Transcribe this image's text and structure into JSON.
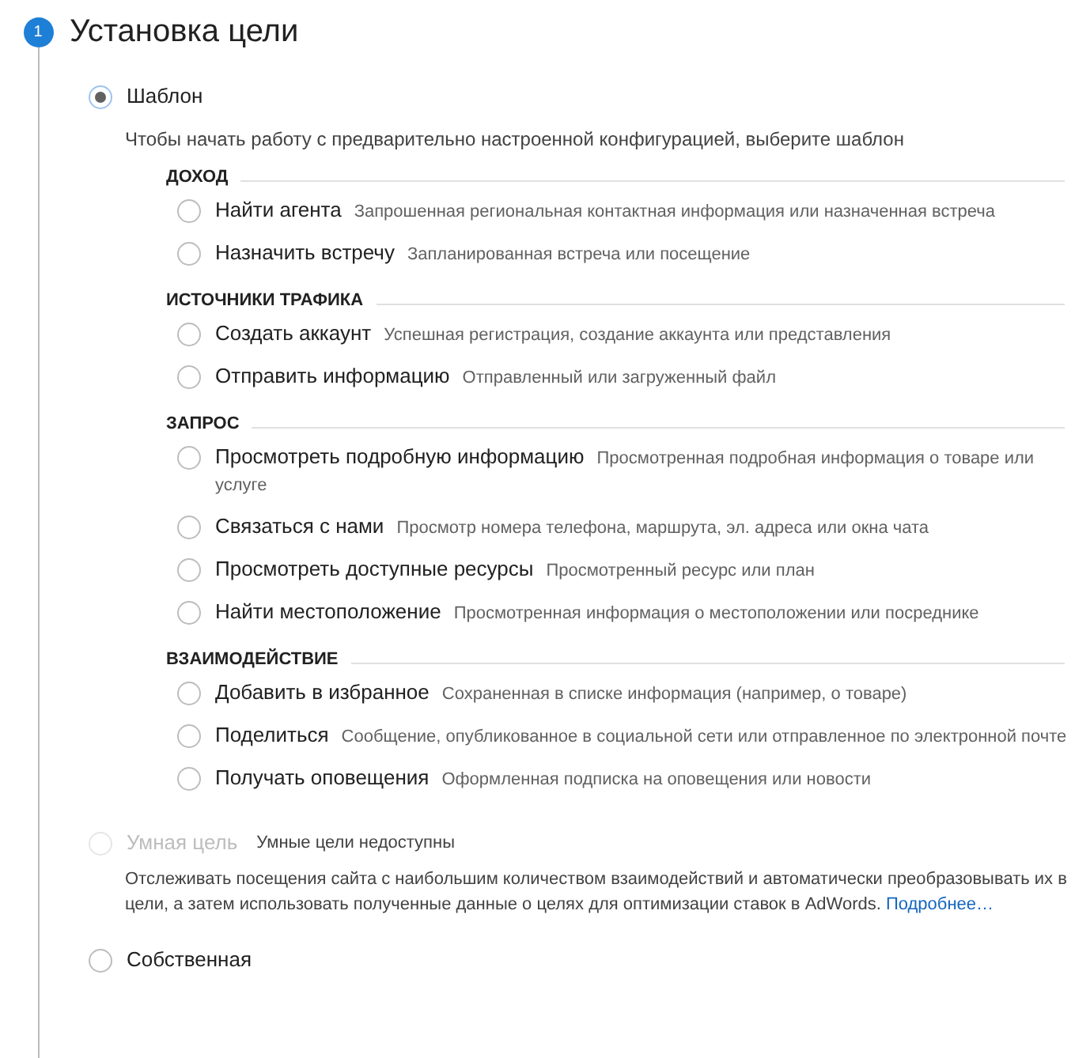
{
  "step": {
    "number": "1",
    "title": "Установка цели"
  },
  "options": [
    {
      "label": "Шаблон",
      "selected": true,
      "disabled": false,
      "description": "Чтобы начать работу с предварительно настроенной конфигурацией, выберите шаблон",
      "groups": [
        {
          "heading": "ДОХОД",
          "items": [
            {
              "label": "Найти агента",
              "description": "Запрошенная региональная контактная информация или назначенная встреча",
              "selected": false
            },
            {
              "label": "Назначить встречу",
              "description": "Запланированная встреча или посещение",
              "selected": false
            }
          ]
        },
        {
          "heading": "ИСТОЧНИКИ ТРАФИКА",
          "items": [
            {
              "label": "Создать аккаунт",
              "description": "Успешная регистрация, создание аккаунта или представления",
              "selected": false
            },
            {
              "label": "Отправить информацию",
              "description": "Отправленный или загруженный файл",
              "selected": false
            }
          ]
        },
        {
          "heading": "ЗАПРОС",
          "items": [
            {
              "label": "Просмотреть подробную информацию",
              "description": "Просмотренная подробная информация о товаре или услуге",
              "selected": false
            },
            {
              "label": "Связаться с нами",
              "description": "Просмотр номера телефона, маршрута, эл. адреса или окна чата",
              "selected": false
            },
            {
              "label": "Просмотреть доступные ресурсы",
              "description": "Просмотренный ресурс или план",
              "selected": false
            },
            {
              "label": "Найти местоположение",
              "description": "Просмотренная информация о местоположении или посреднике",
              "selected": false
            }
          ]
        },
        {
          "heading": "ВЗАИМОДЕЙСТВИЕ",
          "items": [
            {
              "label": "Добавить в избранное",
              "description": "Сохраненная в списке информация (например, о товаре)",
              "selected": false
            },
            {
              "label": "Поделиться",
              "description": "Сообщение, опубликованное в социальной сети или отправленное по электронной почте",
              "selected": false
            },
            {
              "label": "Получать оповещения",
              "description": "Оформленная подписка на оповещения или новости",
              "selected": false
            }
          ]
        }
      ]
    },
    {
      "label": "Умная цель",
      "selected": false,
      "disabled": true,
      "note": "Умные цели недоступны",
      "description": "Отслеживать посещения сайта с наибольшим количеством взаимодействий и автоматически преобразовывать их в цели, а затем использовать полученные данные о целях для оптимизации ставок в AdWords.",
      "link": "Подробнее…"
    },
    {
      "label": "Собственная",
      "selected": false,
      "disabled": false
    }
  ]
}
